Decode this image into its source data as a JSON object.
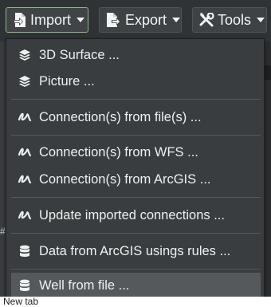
{
  "toolbar": {
    "import_label": "Import",
    "export_label": "Export",
    "tools_label": "Tools"
  },
  "menu": {
    "items": [
      {
        "label": "3D Surface ...",
        "icon": "layers-icon"
      },
      {
        "label": "Picture ...",
        "icon": "layers-icon"
      },
      {
        "label": "Connection(s) from file(s) ...",
        "icon": "squiggle-icon"
      },
      {
        "label": "Connection(s) from WFS ...",
        "icon": "squiggle-icon"
      },
      {
        "label": "Connection(s) from ArcGIS ...",
        "icon": "squiggle-icon"
      },
      {
        "label": "Update imported connections ...",
        "icon": "squiggle-icon"
      },
      {
        "label": "Data from ArcGIS usings rules ...",
        "icon": "database-icon"
      },
      {
        "label": "Well from file ...",
        "icon": "database-icon"
      }
    ]
  },
  "background": {
    "bottom_tab_label": "New tab",
    "left_edge_glyph": "#"
  },
  "colors": {
    "active_border": "#8ab882",
    "menu_bg": "#3a3d3f",
    "highlight_bg": "#56595b"
  }
}
